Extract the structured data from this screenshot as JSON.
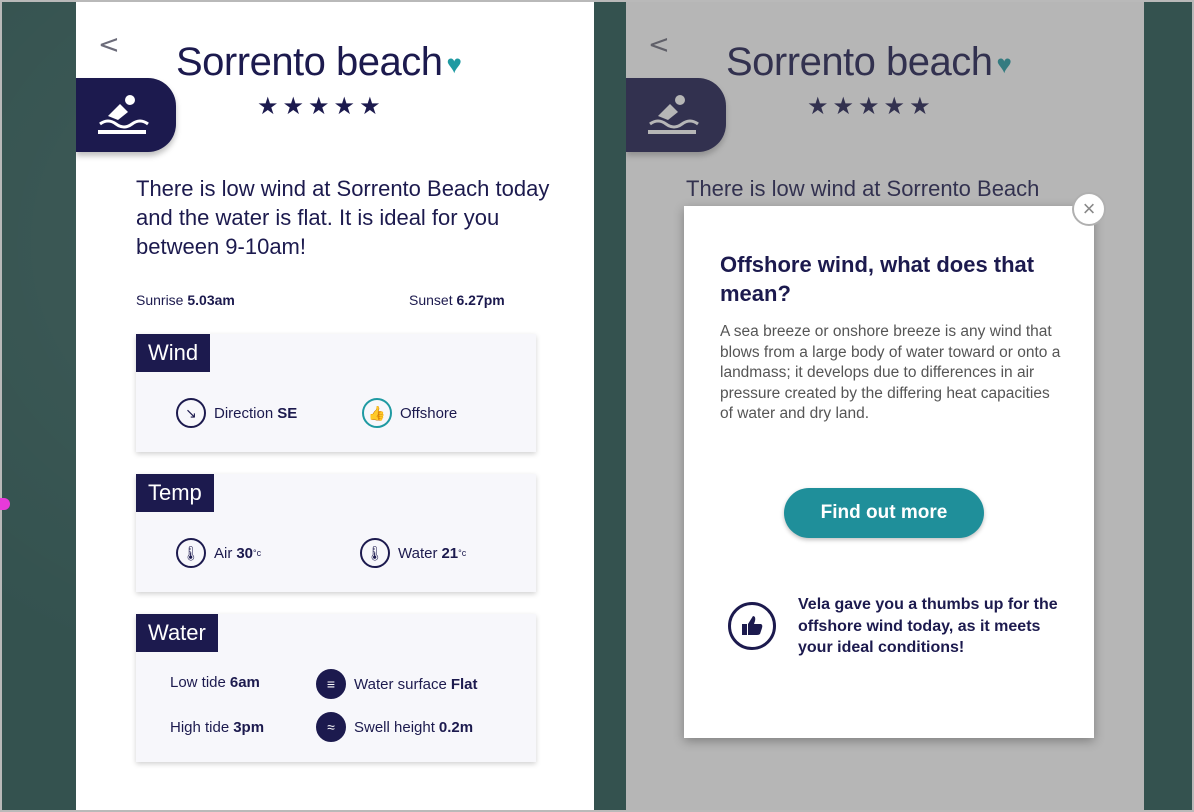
{
  "left": {
    "back_glyph": "<",
    "title": "Sorrento beach",
    "stars": "★★★★★",
    "description": "There is low wind at Sorrento Beach today and the water is flat. It is ideal for you between 9-10am!",
    "sunrise_label": "Sunrise",
    "sunrise_value": "5.03am",
    "sunset_label": "Sunset",
    "sunset_value": "6.27pm",
    "wind": {
      "label": "Wind",
      "direction_label": "Direction",
      "direction_value": "SE",
      "offshore_label": "Offshore"
    },
    "temp": {
      "label": "Temp",
      "air_label": "Air",
      "air_value": "30",
      "air_unit": "°c",
      "water_label": "Water",
      "water_value": "21",
      "water_unit": "°c"
    },
    "water": {
      "label": "Water",
      "low_tide_label": "Low tide",
      "low_tide_value": "6am",
      "high_tide_label": "High tide",
      "high_tide_value": "3pm",
      "surface_label": "Water surface",
      "surface_value": "Flat",
      "swell_label": "Swell height",
      "swell_value": "0.2m"
    }
  },
  "right": {
    "back_glyph": "<",
    "title": "Sorrento beach",
    "stars": "★★★★★",
    "description_partial": "There is low wind at Sorrento Beach",
    "modal": {
      "close_glyph": "×",
      "title": "Offshore wind, what does that mean?",
      "body": "A sea breeze or onshore breeze is any wind that blows from a large body of water toward or onto a landmass; it develops due to differences in air pressure created by the differing heat capacities of water and dry land.",
      "button_label": "Find out more",
      "footer_text": "Vela gave you a thumbs up for the offshore wind today, as it meets your ideal conditions!"
    }
  },
  "colors": {
    "navy": "#1c1a4e",
    "teal": "#1f9aa2",
    "background": "#34524f"
  },
  "icons": [
    "swimmer-icon",
    "heart-icon",
    "compass-arrow-icon",
    "thumbs-up-icon",
    "thermometer-icon",
    "wave-lines-icon",
    "swell-icon",
    "close-icon",
    "back-chevron-icon"
  ]
}
